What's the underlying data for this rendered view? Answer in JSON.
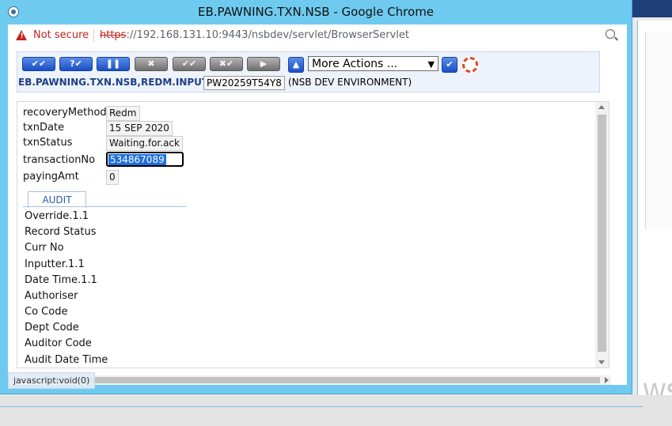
{
  "window": {
    "title": "EB.PAWNING.TXN.NSB - Google Chrome"
  },
  "address_bar": {
    "security_label": "Not secure",
    "url_scheme": "https",
    "url_rest": "://192.168.131.10:9443/nsbdev/servlet/BrowserServlet"
  },
  "toolbar": {
    "buttons": [
      "✔✔",
      "?✔",
      "❚❚",
      "✖",
      "✔✔",
      "✖✔",
      "▶"
    ],
    "more_actions": "More Actions ...",
    "txn_title": "EB.PAWNING.TXN.NSB,REDM.INPUT",
    "txn_id": "PW20259T54Y8",
    "environment": "(NSB DEV ENVIRONMENT)"
  },
  "form": {
    "fields": [
      {
        "label": "recoveryMethod",
        "value": "Redm"
      },
      {
        "label": "txnDate",
        "value": "15 SEP 2020"
      },
      {
        "label": "txnStatus",
        "value": "Waiting.for.ack"
      },
      {
        "label": "transactionNo",
        "value": "534867089"
      },
      {
        "label": "payingAmt",
        "value": "0"
      }
    ],
    "audit_tab": "AUDIT",
    "audit_items": [
      "Override.1.1",
      "Record Status",
      "Curr No",
      "Inputter.1.1",
      "Date Time.1.1",
      "Authoriser",
      "Co Code",
      "Dept Code",
      "Auditor Code",
      "Audit Date Time"
    ]
  },
  "status_bar": {
    "link": "javascript:void(0)"
  },
  "background": {
    "side_text": "WS"
  },
  "colors": {
    "window_frame": "#6ecbef",
    "toolbar_blue": "#1b4fc4",
    "title_text": "#1f3f86",
    "warning": "#c5221f"
  }
}
